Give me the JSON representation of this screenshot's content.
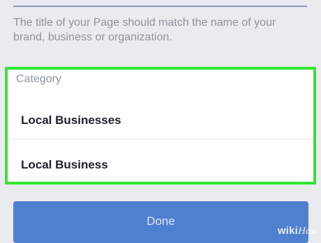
{
  "page_name": {
    "helper_text": "The title of your Page should match the name of your brand, business or organization."
  },
  "category": {
    "label": "Category",
    "options": [
      {
        "label": "Local Businesses"
      },
      {
        "label": "Local Business"
      }
    ],
    "highlight_color": "#33e62e"
  },
  "done_button": {
    "label": "Done"
  },
  "watermark": {
    "wiki": "wiki",
    "how": "How"
  },
  "colors": {
    "background": "#e9ebee",
    "button": "#4f7fcf",
    "underline": "#3b5998"
  }
}
